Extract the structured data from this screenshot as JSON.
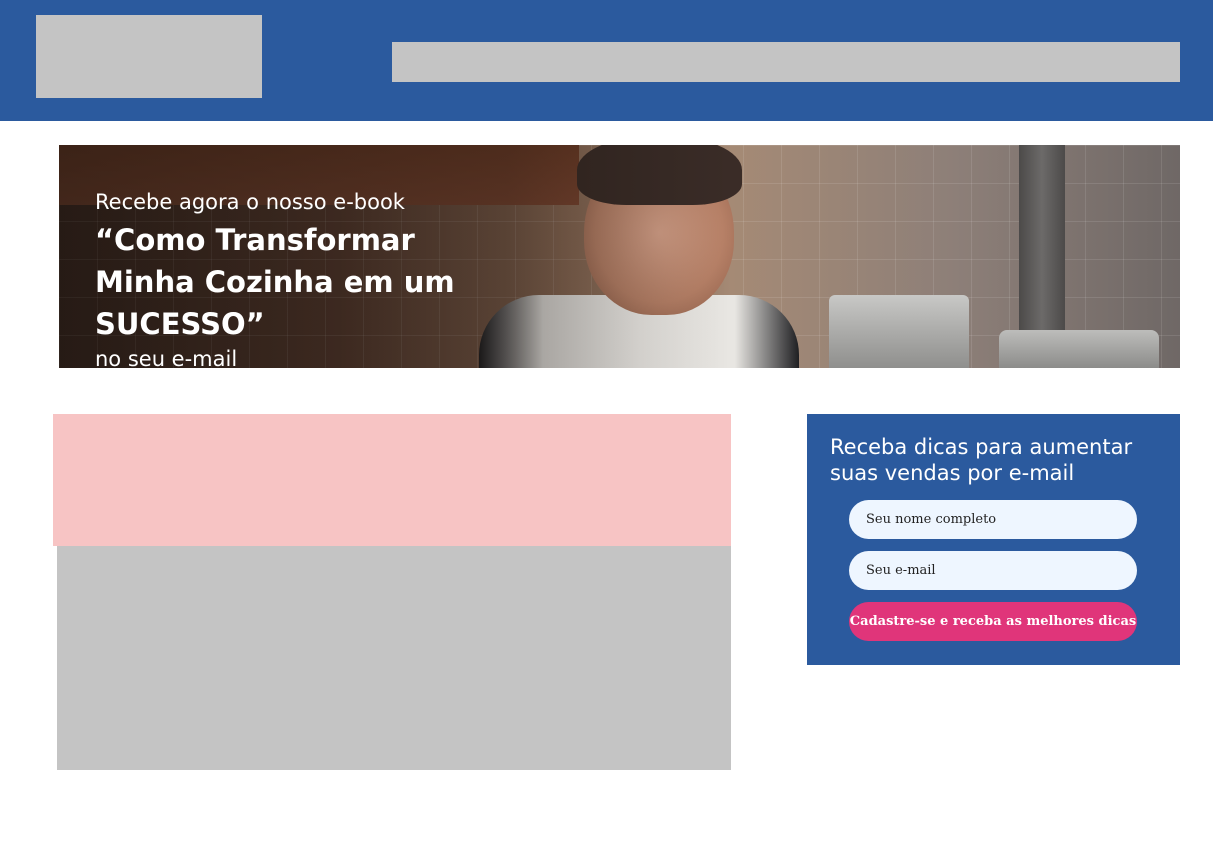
{
  "hero": {
    "line1": "Recebe agora o nosso e-book",
    "title": "“Como Transformar Minha Cozinha em um SUCESSO”",
    "line3": "no seu e-mail"
  },
  "signup": {
    "title": "Receba dicas para aumentar suas vendas por e-mail",
    "name_placeholder": "Seu nome completo",
    "email_placeholder": "Seu e-mail",
    "submit_label": "Cadastre-se e receba as melhores dicas"
  },
  "colors": {
    "header_blue": "#2b5a9e",
    "placeholder_gray": "#c4c4c4",
    "placeholder_pink": "#f7c4c4",
    "input_bg": "#eef6ff",
    "cta_pink": "#e0357a"
  }
}
